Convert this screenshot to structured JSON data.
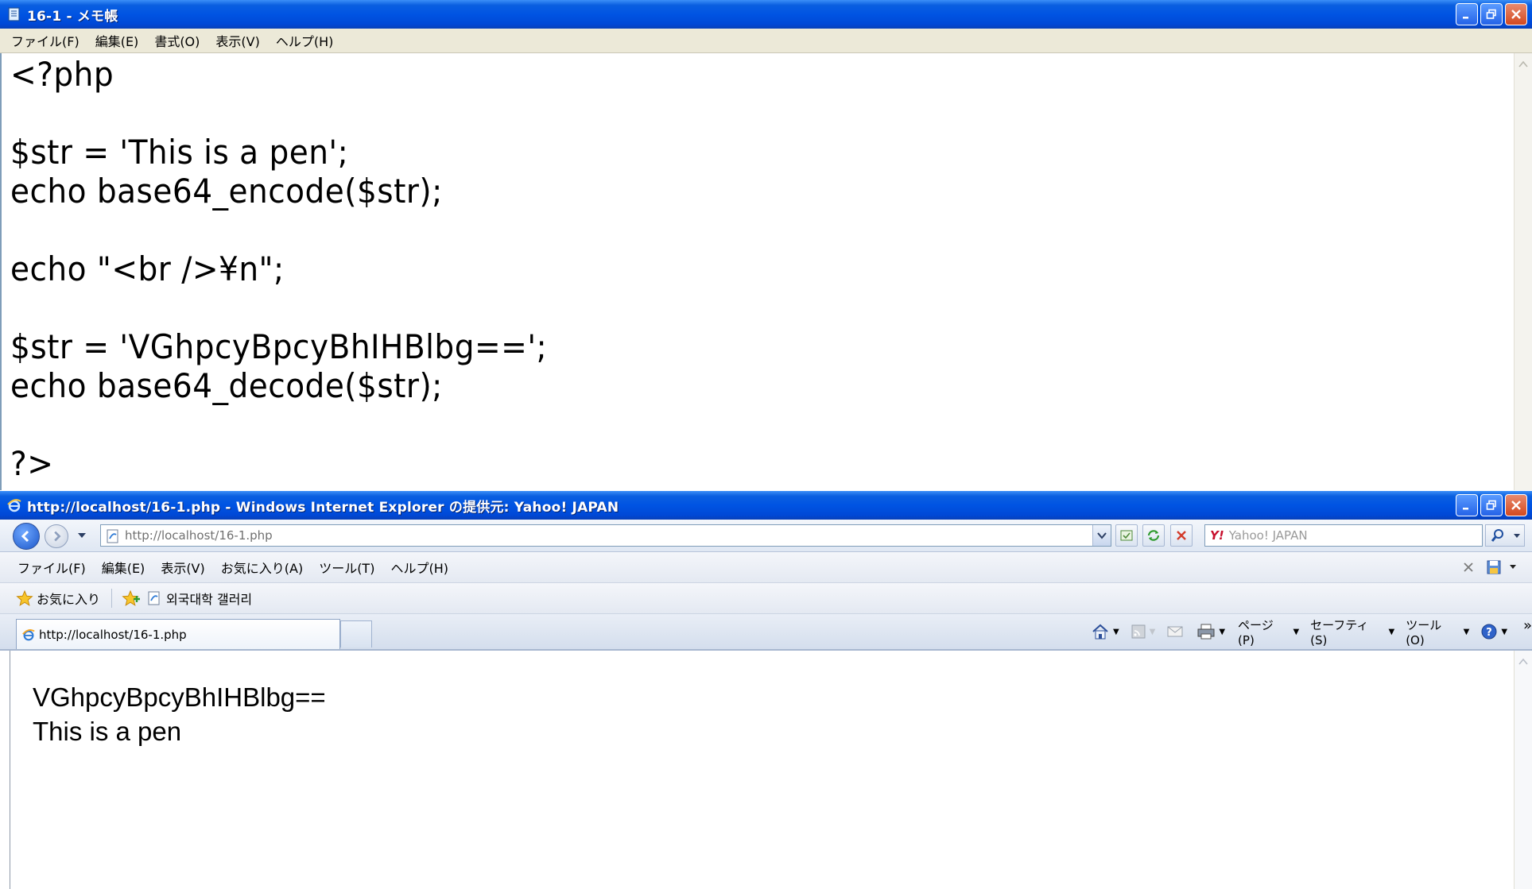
{
  "notepad": {
    "title": "16-1 - メモ帳",
    "menu": [
      "ファイル(F)",
      "編集(E)",
      "書式(O)",
      "表示(V)",
      "ヘルプ(H)"
    ],
    "lines": [
      "<?php",
      "",
      "$str = 'This is a pen';",
      "echo base64_encode($str);",
      "",
      "echo \"<br />¥n\";",
      "",
      "$str = 'VGhpcyBpcyBhIHBlbg==';",
      "echo base64_decode($str);",
      "",
      "?>"
    ]
  },
  "ie": {
    "title": "http://localhost/16-1.php - Windows Internet Explorer の提供元: Yahoo! JAPAN",
    "address": "http://localhost/16-1.php",
    "search_placeholder": "Yahoo! JAPAN",
    "menu": [
      "ファイル(F)",
      "編集(E)",
      "表示(V)",
      "お気に入り(A)",
      "ツール(T)",
      "ヘルプ(H)"
    ],
    "favorites_label": "お気に入り",
    "favorites_item": "외국대학 갤러리",
    "tab_label": "http://localhost/16-1.php",
    "command_bar": {
      "page": "ページ(P)",
      "safety": "セーフティ(S)",
      "tools": "ツール(O)"
    },
    "content": [
      "VGhpcyBpcyBhIHBlbg==",
      "This is a pen"
    ]
  },
  "colors": {
    "xp_titlebar": "#0054e3",
    "close_button": "#d3491f",
    "menubar_bg": "#ece9d8"
  }
}
